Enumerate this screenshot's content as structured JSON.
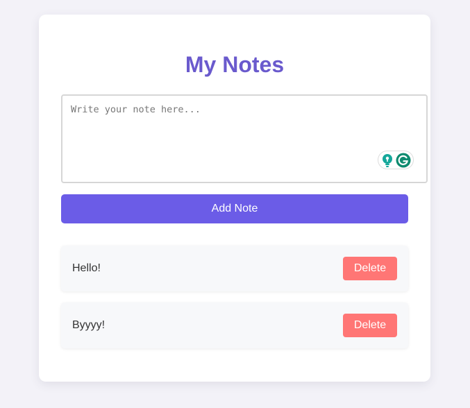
{
  "app": {
    "title": "My Notes"
  },
  "input": {
    "placeholder": "Write your note here...",
    "value": ""
  },
  "add_button_label": "Add Note",
  "notes": [
    {
      "text": "Hello!",
      "delete_label": "Delete"
    },
    {
      "text": "Byyyy!",
      "delete_label": "Delete"
    }
  ],
  "icons": {
    "grammarly_suggestion": "lightbulb-icon",
    "grammarly_logo": "grammarly-icon"
  },
  "colors": {
    "accent": "#6b5ce7",
    "title": "#6a5acd",
    "delete": "#ff7675",
    "grammarly": "#15a79a"
  }
}
